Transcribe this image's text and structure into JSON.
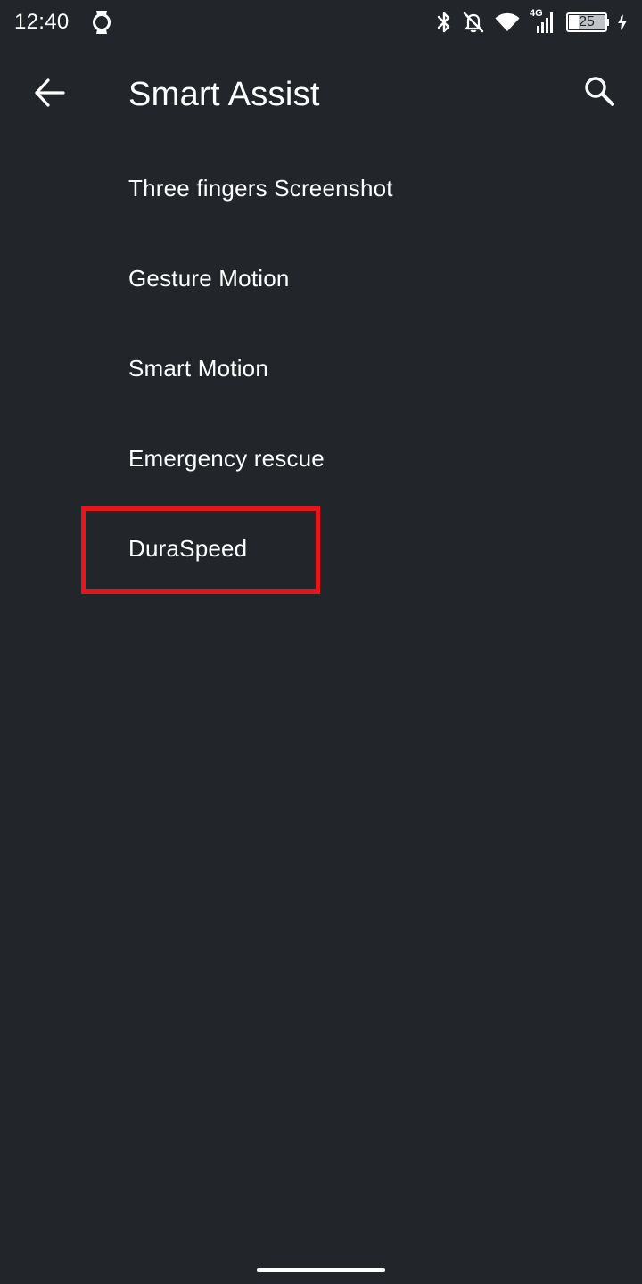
{
  "status_bar": {
    "time": "12:40",
    "network_type": "4G",
    "battery_level": "25",
    "icons": [
      "watch-icon",
      "bluetooth-icon",
      "notifications-off-icon",
      "wifi-icon",
      "cellular-signal-icon",
      "battery-icon",
      "charging-icon"
    ]
  },
  "toolbar": {
    "title": "Smart Assist",
    "back_icon": "arrow-left-icon",
    "search_icon": "search-icon"
  },
  "settings": {
    "items": [
      {
        "label": "Three fingers Screenshot"
      },
      {
        "label": "Gesture Motion"
      },
      {
        "label": "Smart Motion"
      },
      {
        "label": "Emergency rescue"
      },
      {
        "label": "DuraSpeed"
      }
    ]
  },
  "colors": {
    "background": "#22262b",
    "text": "#ffffff",
    "highlight": "#e8141c"
  }
}
